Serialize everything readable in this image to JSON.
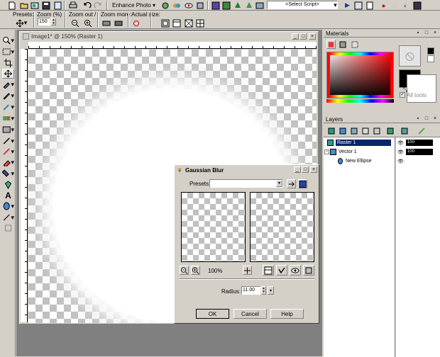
{
  "toolbar": {
    "enhance_photo_label": "Enhance Photo",
    "script_select_value": "<Select Script>"
  },
  "options_bar": {
    "presets_label": "Presets:",
    "zoom_label": "Zoom (%)",
    "zoom_value": "150",
    "zoom_out_in_label": "Zoom out / in:",
    "zoom_more_label": "Zoom more:",
    "actual_size_label": "Actual size:"
  },
  "document": {
    "title": "Image1* @ 150% (Raster 1)"
  },
  "materials": {
    "title": "Materials",
    "all_tools_label": "All tools"
  },
  "layers": {
    "title": "Layers",
    "items": [
      {
        "name": "Raster 1",
        "opacity": "100"
      },
      {
        "name": "Vector 1",
        "opacity": "100"
      },
      {
        "name": "New Ellipse",
        "opacity": ""
      }
    ]
  },
  "dialog": {
    "title": "Gaussian Blur",
    "presets_label": "Presets:",
    "preset_value": "",
    "zoom_value": "100%",
    "radius_label": "Radius:",
    "radius_value": "11.00",
    "ok_label": "OK",
    "cancel_label": "Cancel",
    "help_label": "Help"
  },
  "colors": {
    "title_active": "#0a246a",
    "workspace": "#808080",
    "selection": "#0a246a"
  }
}
